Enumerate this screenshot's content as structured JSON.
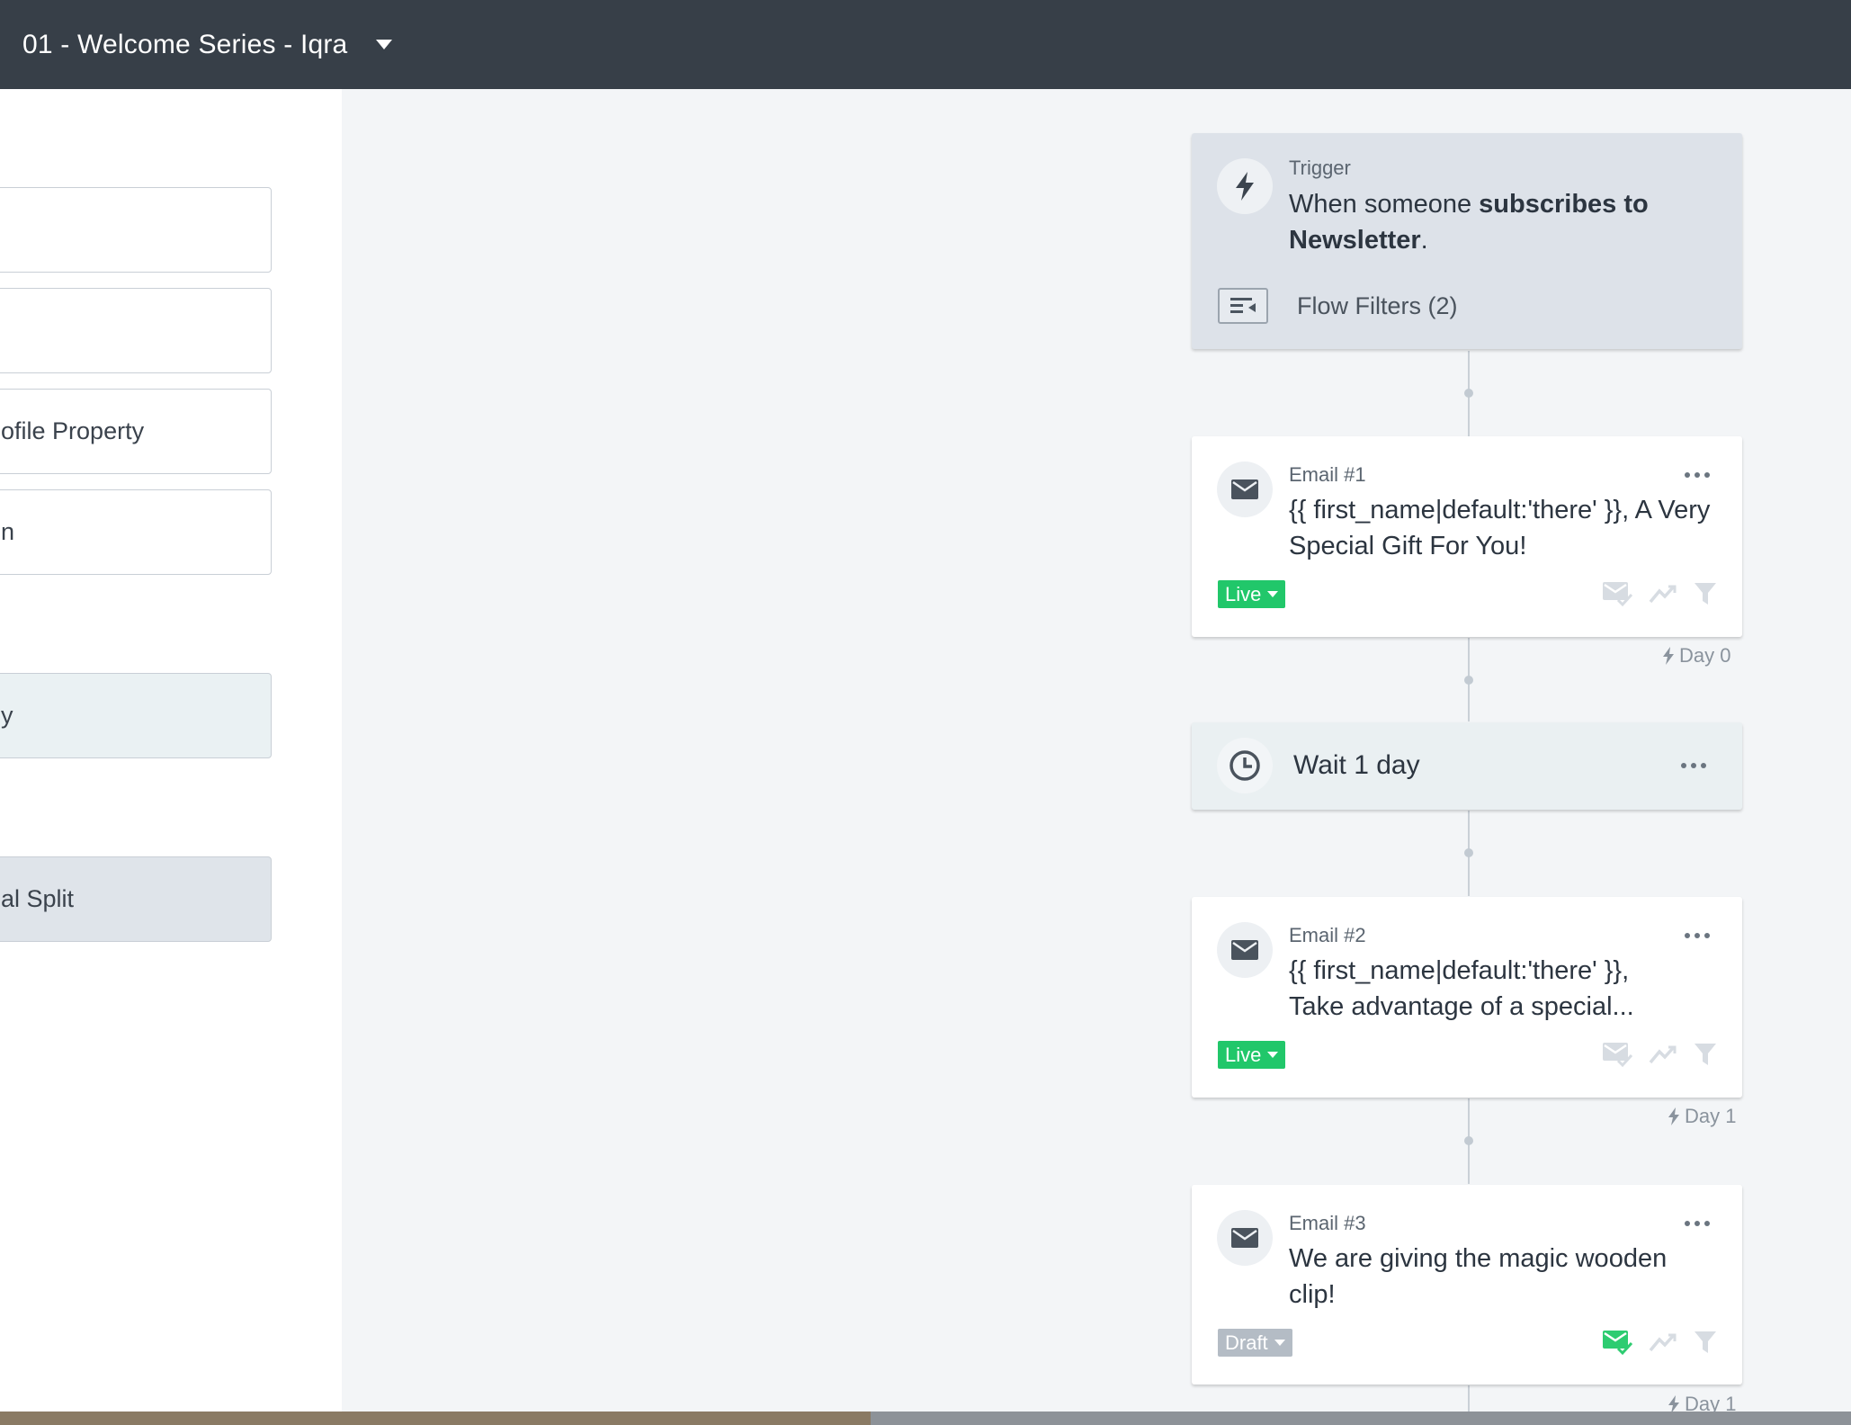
{
  "header": {
    "title": "01 - Welcome Series - Iqra"
  },
  "sidebar": {
    "actions": [
      {
        "label": ""
      },
      {
        "label": ""
      },
      {
        "label": "ofile Property"
      },
      {
        "label": "n"
      },
      {
        "label": "y"
      },
      {
        "label": "al Split"
      }
    ]
  },
  "flow": {
    "trigger": {
      "label": "Trigger",
      "text_prefix": "When someone ",
      "text_bold": "subscribes to Newsletter",
      "text_suffix": ".",
      "filters_label": "Flow Filters (2)"
    },
    "emails": [
      {
        "label": "Email #1",
        "subject": "{{ first_name|default:'there' }}, A Very Special Gift For You!",
        "status": "Live",
        "day": "Day 0"
      },
      {
        "label": "Email #2",
        "subject": "{{ first_name|default:'there' }}, Take advantage of a special...",
        "status": "Live",
        "day": "Day 1"
      },
      {
        "label": "Email #3",
        "subject": "We are giving the magic wooden clip!",
        "status": "Draft",
        "day": "Day 1"
      }
    ],
    "wait": {
      "label": "Wait 1 day"
    }
  },
  "icons": {
    "trigger": "lightning-icon",
    "email": "envelope-icon",
    "wait": "clock-icon",
    "filters": "filter-list-icon",
    "smart_sending": "mail-check-icon",
    "analytics": "trend-icon",
    "filter": "funnel-icon"
  },
  "colors": {
    "header_bg": "#373f48",
    "live": "#21c76a",
    "draft": "#b4bcc5",
    "smart_sending_on": "#2ecc71"
  }
}
